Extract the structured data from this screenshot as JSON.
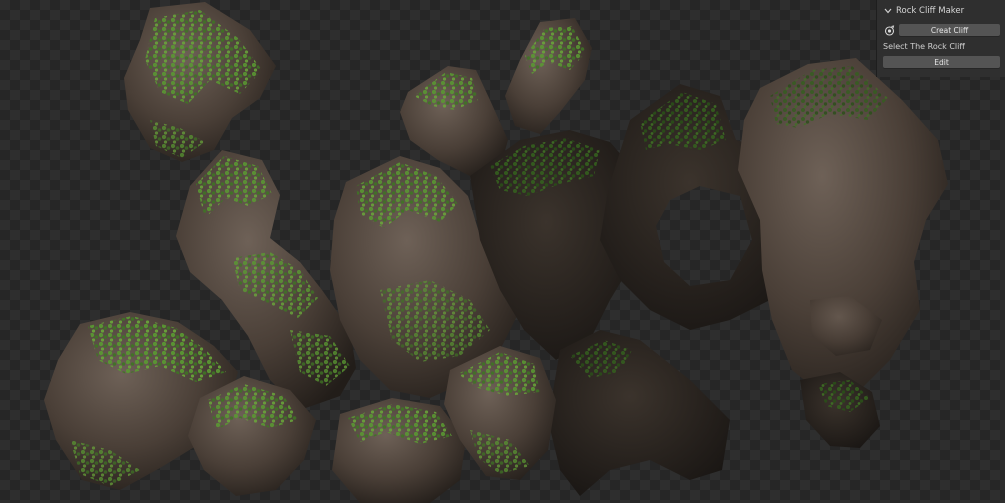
{
  "panel": {
    "title": "Rock Cliff Maker",
    "create_button_label": "Creat Cliff",
    "select_label": "Select The Rock Cliff",
    "edit_button_label": "Edit",
    "icons": {
      "collapse": "chevron-down-icon",
      "operator": "rock-generator-icon"
    }
  },
  "viewport": {
    "background": "transparent-checker",
    "colors": {
      "rock": "#5e5148",
      "rock_dark": "#2e2822",
      "moss": "#4f8a2c",
      "moss_dark": "#2f5a1c"
    }
  }
}
